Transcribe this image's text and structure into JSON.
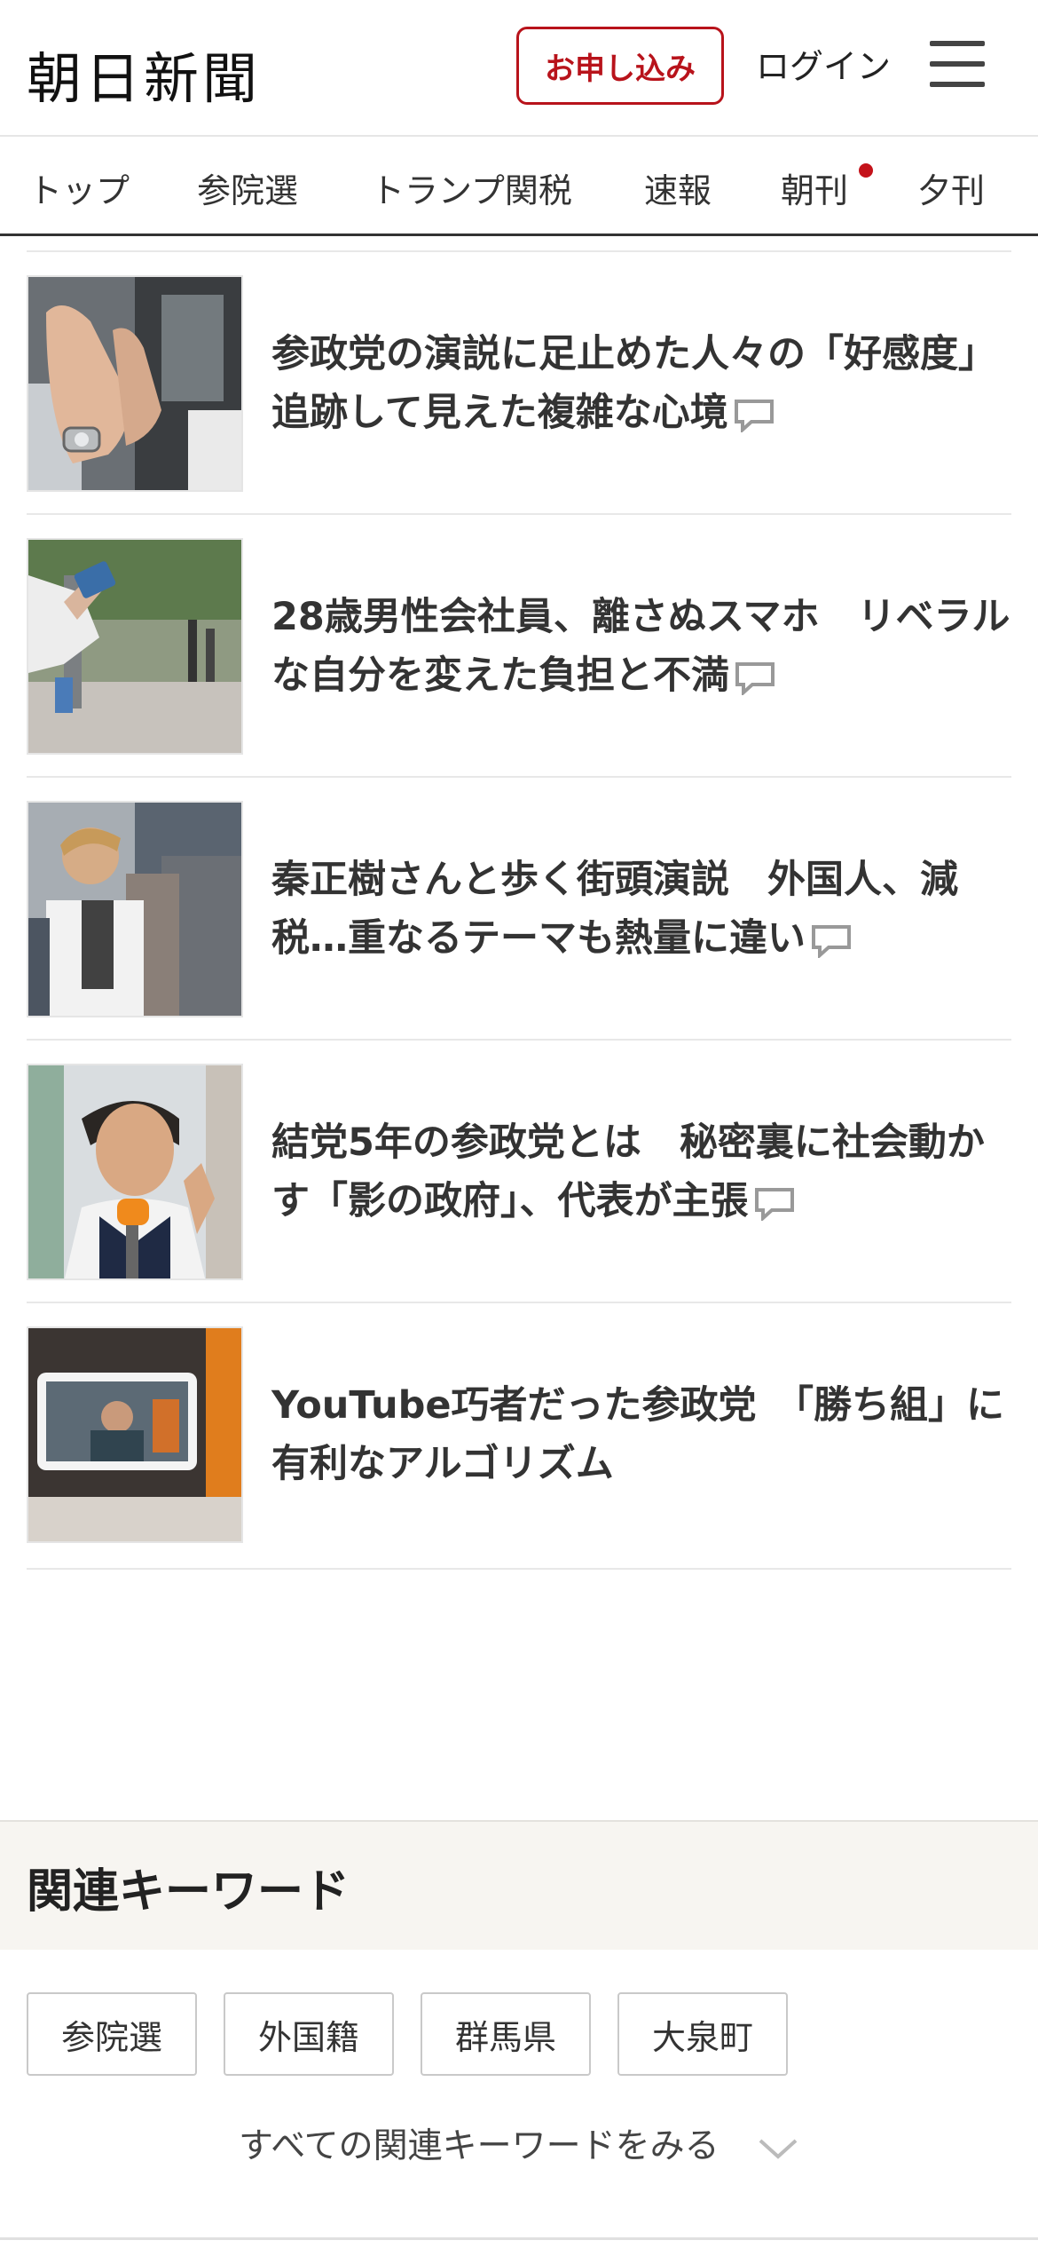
{
  "header": {
    "logo": "朝日新聞",
    "apply_label": "お申し込み",
    "login_label": "ログイン",
    "menu_icon": "hamburger-menu-icon",
    "accent_color": "#b8131b"
  },
  "nav": {
    "items": [
      {
        "label": "トップ"
      },
      {
        "label": "参院選"
      },
      {
        "label": "トランプ関税"
      },
      {
        "label": "速報"
      },
      {
        "label": "朝刊",
        "badge": "new-dot"
      },
      {
        "label": "夕刊"
      }
    ]
  },
  "articles": [
    {
      "headline": "参政党の演説に足止めた人々の「好感度」 追跡して見えた複雑な心境",
      "has_comments": true,
      "thumb": "hands-clapping-photo"
    },
    {
      "headline": "28歳男性会社員、離さぬスマホ　リベラルな自分を変えた負担と不満",
      "has_comments": true,
      "thumb": "street-smartphone-photo"
    },
    {
      "headline": "秦正樹さんと歩く街頭演説　外国人、減税…重なるテーマも熱量に違い",
      "has_comments": true,
      "thumb": "man-in-crowd-photo"
    },
    {
      "headline": "結党5年の参政党とは　秘密裏に社会動かす「影の政府」、代表が主張",
      "has_comments": true,
      "thumb": "speaker-microphone-photo"
    },
    {
      "headline": "YouTube巧者だった参政党　「勝ち組」に有利なアルゴリズム",
      "has_comments": false,
      "thumb": "phone-recording-photo"
    }
  ],
  "keywords": {
    "title": "関連キーワード",
    "tags": [
      "参院選",
      "外国籍",
      "群馬県",
      "大泉町"
    ],
    "more_label": "すべての関連キーワードをみる"
  }
}
